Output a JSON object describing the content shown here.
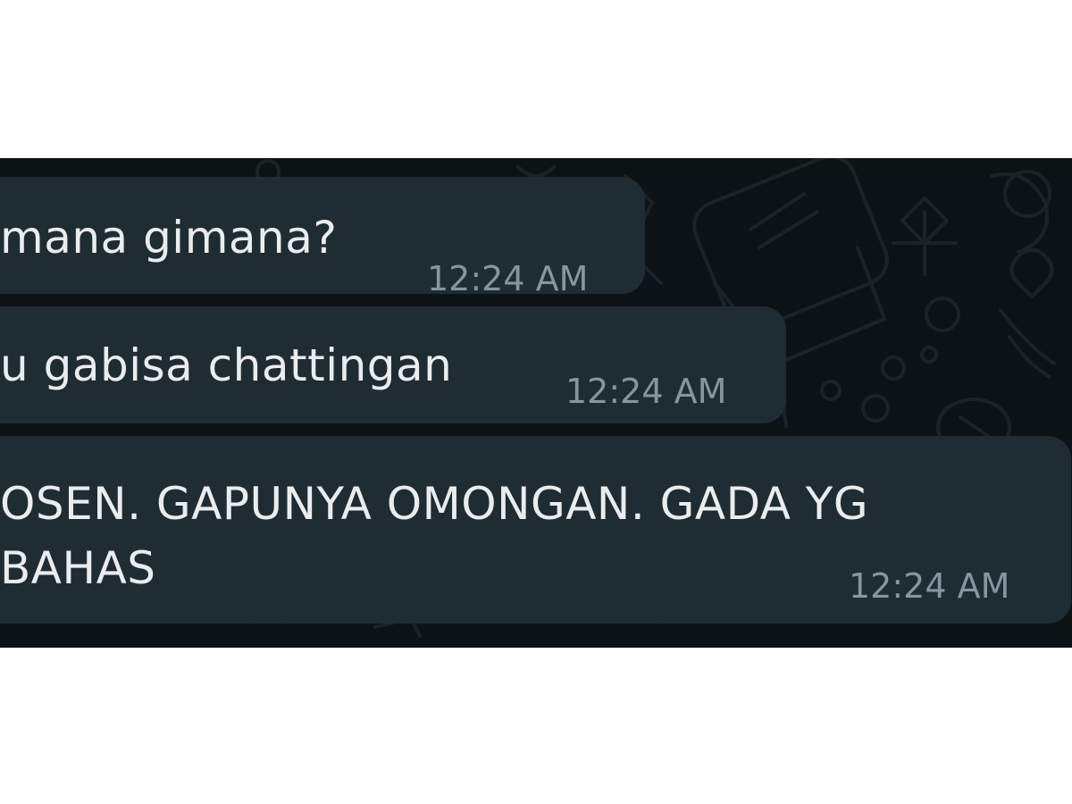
{
  "chat": {
    "messages": [
      {
        "text": "mana gimana?",
        "time": "12:24 AM"
      },
      {
        "text": "u gabisa chattingan",
        "time": "12:24 AM"
      },
      {
        "text_line1": "OSEN. GAPUNYA OMONGAN. GADA YG",
        "text_line2": "BAHAS",
        "time": "12:24 AM"
      }
    ]
  },
  "colors": {
    "background": "#0c1317",
    "bubble": "#202c33",
    "message_text": "#e9edef",
    "timestamp": "#8696a0"
  }
}
